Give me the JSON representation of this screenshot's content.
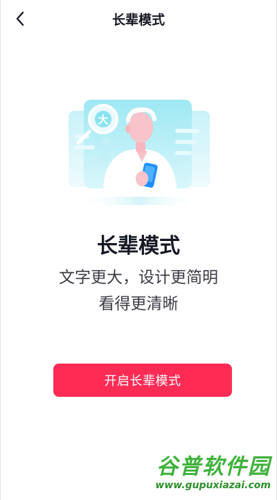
{
  "nav": {
    "title": "长辈模式"
  },
  "illustration": {
    "badge_text": "大"
  },
  "content": {
    "title": "长辈模式",
    "description_line_1": "文字更大，设计更简明",
    "description_line_2": "看得更清晰"
  },
  "actions": {
    "enable_label": "开启长辈模式"
  },
  "watermark": {
    "title": "谷普软件园",
    "url": "www.gupuxiazai.com"
  },
  "colors": {
    "primary_button": "#fe2c55",
    "illustration_teal": "#8be3f0",
    "watermark_green": "#3fb13b"
  },
  "icons": {
    "back": "chevron-left-icon",
    "magnifier": "magnifier-icon",
    "phone": "phone-icon"
  }
}
